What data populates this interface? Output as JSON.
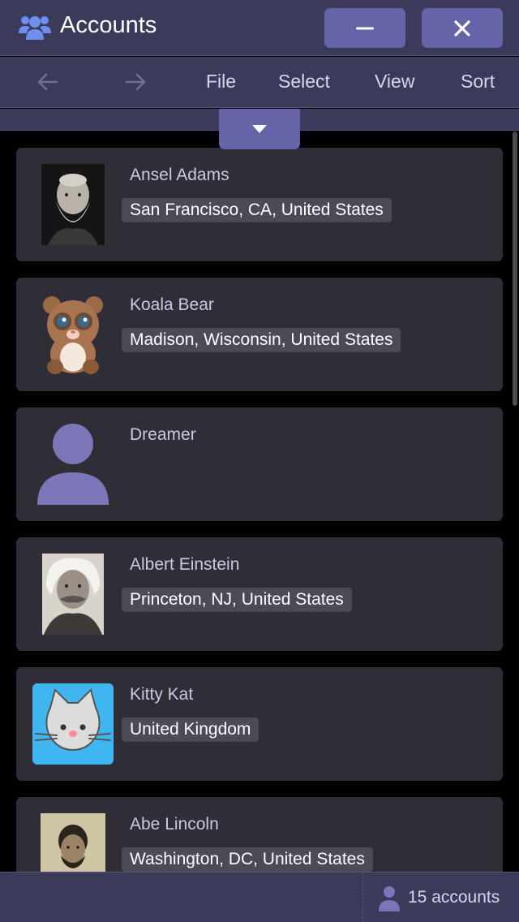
{
  "window": {
    "title": "Accounts",
    "title_icon": "users-icon",
    "minimize_icon": "minimize-icon",
    "close_icon": "close-icon"
  },
  "menubar": {
    "back_icon": "arrow-left-icon",
    "forward_icon": "arrow-right-icon",
    "items": [
      "File",
      "Select",
      "View",
      "Sort"
    ]
  },
  "expand_icon": "caret-down-icon",
  "accounts": [
    {
      "name": "Ansel Adams",
      "location": "San Francisco, CA, United States",
      "avatar": "photo-portrait"
    },
    {
      "name": "Koala Bear",
      "location": "Madison, Wisconsin, United States",
      "avatar": "koala-avatar"
    },
    {
      "name": "Dreamer",
      "location": "",
      "avatar": "default-user-avatar"
    },
    {
      "name": "Albert Einstein",
      "location": "Princeton, NJ, United States",
      "avatar": "photo-portrait"
    },
    {
      "name": "Kitty Kat",
      "location": "United Kingdom",
      "avatar": "cat-avatar"
    },
    {
      "name": "Abe Lincoln",
      "location": "Washington, DC, United States",
      "avatar": "photo-portrait"
    }
  ],
  "status": {
    "count_text": "15 accounts",
    "icon": "user-icon"
  },
  "colors": {
    "chrome": "#3b3a5b",
    "accent": "#6664a8",
    "card": "#2f2e36",
    "chip": "#4b4a55",
    "avatar_purple": "#7a76b8",
    "cat_blue": "#3fb6f0"
  }
}
